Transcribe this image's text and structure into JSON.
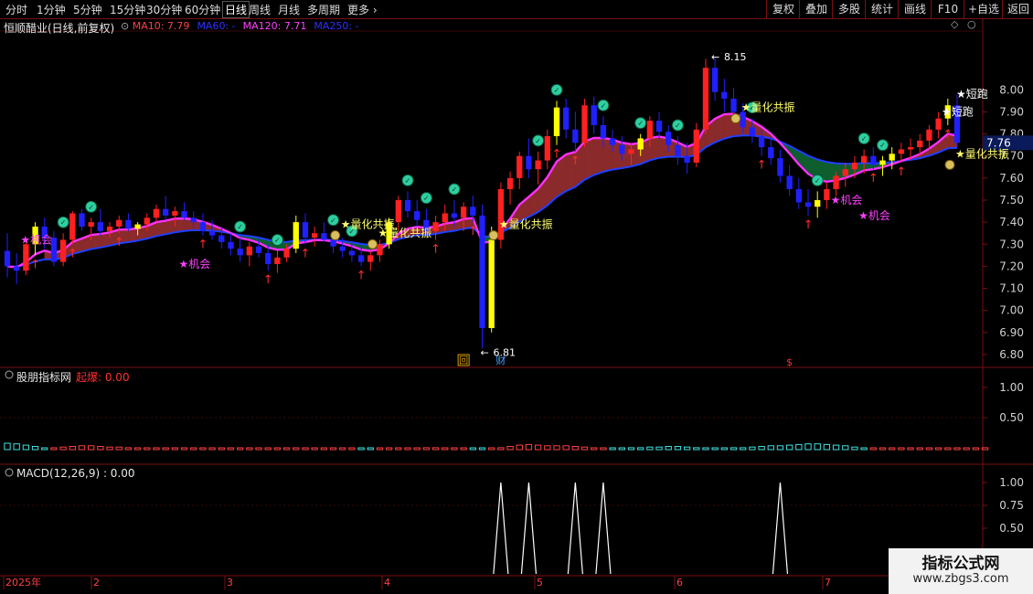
{
  "toolbar": {
    "periods": [
      "分时",
      "1分钟",
      "5分钟",
      "15分钟",
      "30分钟",
      "60分钟",
      "日线",
      "周线",
      "月线",
      "多周期",
      "更多"
    ],
    "active_period": "日线",
    "right_buttons": [
      "复权",
      "叠加",
      "多股",
      "统计",
      "画线",
      "F10",
      "+自选",
      "返回"
    ]
  },
  "main_panel": {
    "title": "恒顺醋业(日线,前复权)",
    "ma_labels": [
      {
        "text": "MA10: 7.79",
        "color": "#ff4040"
      },
      {
        "text": "MA60: -",
        "color": "#3030ff"
      },
      {
        "text": "MA120: 7.71",
        "color": "#ff40ff"
      },
      {
        "text": "MA250: -",
        "color": "#3030ff"
      }
    ],
    "price_ticks": [
      "8.00",
      "7.90",
      "7.80",
      "7.70",
      "7.60",
      "7.50",
      "7.40",
      "7.30",
      "7.20",
      "7.10",
      "7.00",
      "6.90",
      "6.80"
    ],
    "current_price": "7.76",
    "high_label": "8.15",
    "low_label": "6.81",
    "signals": {
      "opportunity": "★机会",
      "resonance": "★量化共振",
      "short_run": "★短跑"
    },
    "markers": {
      "review": "回",
      "finance": "财",
      "dollar": "$"
    }
  },
  "sub_panel_1": {
    "title": "股朋指标网",
    "value_label": "起爆: 0.00",
    "ticks": [
      "1.00",
      "0.50"
    ]
  },
  "sub_panel_2": {
    "title": "MACD(12,26,9) : 0.00",
    "ticks": [
      "1.00",
      "0.75",
      "0.50"
    ]
  },
  "date_axis": {
    "labels": [
      "2025年",
      "2",
      "3",
      "4",
      "5",
      "6",
      "7"
    ]
  },
  "watermark": {
    "line1": "指标公式网",
    "line2": "www.zbgs3.com"
  },
  "colors": {
    "up": "#ff2020",
    "down": "#2020ff",
    "yellow": "#ffff00",
    "grid": "#7a1010",
    "cloud_green": "#0e5e2e",
    "cloud_red": "#8a2a2a",
    "ma_blue": "#2040ff",
    "ma_magenta": "#ff30ff"
  },
  "chart_data": {
    "type": "candlestick",
    "y_range": [
      6.75,
      8.25
    ],
    "candles": [
      [
        7.27,
        7.35,
        7.15,
        7.2
      ],
      [
        7.2,
        7.26,
        7.12,
        7.18
      ],
      [
        7.18,
        7.32,
        7.16,
        7.3
      ],
      [
        7.3,
        7.4,
        7.25,
        7.38
      ],
      [
        7.38,
        7.42,
        7.28,
        7.33
      ],
      [
        7.33,
        7.36,
        7.2,
        7.22
      ],
      [
        7.22,
        7.35,
        7.2,
        7.32
      ],
      [
        7.32,
        7.45,
        7.3,
        7.44
      ],
      [
        7.44,
        7.46,
        7.36,
        7.38
      ],
      [
        7.38,
        7.42,
        7.32,
        7.4
      ],
      [
        7.4,
        7.46,
        7.34,
        7.36
      ],
      [
        7.36,
        7.4,
        7.33,
        7.38
      ],
      [
        7.38,
        7.43,
        7.35,
        7.41
      ],
      [
        7.41,
        7.44,
        7.36,
        7.37
      ],
      [
        7.37,
        7.4,
        7.34,
        7.39
      ],
      [
        7.39,
        7.44,
        7.36,
        7.42
      ],
      [
        7.42,
        7.48,
        7.4,
        7.46
      ],
      [
        7.46,
        7.52,
        7.41,
        7.43
      ],
      [
        7.43,
        7.47,
        7.38,
        7.45
      ],
      [
        7.45,
        7.49,
        7.41,
        7.42
      ],
      [
        7.42,
        7.45,
        7.37,
        7.4
      ],
      [
        7.4,
        7.44,
        7.34,
        7.36
      ],
      [
        7.36,
        7.41,
        7.32,
        7.34
      ],
      [
        7.34,
        7.38,
        7.28,
        7.31
      ],
      [
        7.31,
        7.35,
        7.25,
        7.28
      ],
      [
        7.28,
        7.33,
        7.22,
        7.25
      ],
      [
        7.25,
        7.31,
        7.2,
        7.29
      ],
      [
        7.29,
        7.33,
        7.24,
        7.26
      ],
      [
        7.26,
        7.3,
        7.18,
        7.21
      ],
      [
        7.21,
        7.27,
        7.17,
        7.24
      ],
      [
        7.24,
        7.3,
        7.22,
        7.28
      ],
      [
        7.28,
        7.43,
        7.26,
        7.4
      ],
      [
        7.4,
        7.44,
        7.3,
        7.33
      ],
      [
        7.33,
        7.38,
        7.29,
        7.35
      ],
      [
        7.35,
        7.4,
        7.31,
        7.32
      ],
      [
        7.32,
        7.36,
        7.26,
        7.29
      ],
      [
        7.29,
        7.33,
        7.24,
        7.27
      ],
      [
        7.27,
        7.31,
        7.22,
        7.25
      ],
      [
        7.25,
        7.3,
        7.2,
        7.22
      ],
      [
        7.22,
        7.27,
        7.18,
        7.25
      ],
      [
        7.25,
        7.32,
        7.22,
        7.3
      ],
      [
        7.3,
        7.42,
        7.28,
        7.4
      ],
      [
        7.4,
        7.52,
        7.36,
        7.5
      ],
      [
        7.5,
        7.54,
        7.42,
        7.45
      ],
      [
        7.45,
        7.5,
        7.38,
        7.41
      ],
      [
        7.41,
        7.46,
        7.34,
        7.36
      ],
      [
        7.36,
        7.43,
        7.32,
        7.4
      ],
      [
        7.4,
        7.48,
        7.36,
        7.44
      ],
      [
        7.44,
        7.5,
        7.38,
        7.42
      ],
      [
        7.42,
        7.49,
        7.36,
        7.47
      ],
      [
        7.47,
        7.52,
        7.4,
        7.43
      ],
      [
        7.43,
        7.48,
        6.83,
        6.92
      ],
      [
        6.92,
        7.38,
        6.9,
        7.32
      ],
      [
        7.32,
        7.58,
        7.28,
        7.55
      ],
      [
        7.55,
        7.63,
        7.48,
        7.6
      ],
      [
        7.6,
        7.72,
        7.55,
        7.7
      ],
      [
        7.7,
        7.78,
        7.6,
        7.64
      ],
      [
        7.64,
        7.72,
        7.57,
        7.68
      ],
      [
        7.68,
        7.82,
        7.64,
        7.79
      ],
      [
        7.79,
        7.95,
        7.75,
        7.92
      ],
      [
        7.92,
        7.96,
        7.78,
        7.82
      ],
      [
        7.82,
        7.9,
        7.72,
        7.76
      ],
      [
        7.76,
        7.96,
        7.74,
        7.93
      ],
      [
        7.93,
        7.97,
        7.8,
        7.84
      ],
      [
        7.84,
        7.88,
        7.74,
        7.78
      ],
      [
        7.78,
        7.82,
        7.72,
        7.75
      ],
      [
        7.75,
        7.79,
        7.68,
        7.71
      ],
      [
        7.71,
        7.76,
        7.66,
        7.73
      ],
      [
        7.73,
        7.8,
        7.7,
        7.78
      ],
      [
        7.78,
        7.88,
        7.74,
        7.86
      ],
      [
        7.86,
        7.9,
        7.78,
        7.81
      ],
      [
        7.81,
        7.84,
        7.72,
        7.75
      ],
      [
        7.75,
        7.79,
        7.66,
        7.7
      ],
      [
        7.7,
        7.76,
        7.62,
        7.67
      ],
      [
        7.67,
        7.85,
        7.65,
        7.82
      ],
      [
        7.82,
        8.14,
        7.8,
        8.1
      ],
      [
        8.1,
        8.15,
        7.95,
        7.99
      ],
      [
        7.99,
        8.05,
        7.9,
        7.96
      ],
      [
        7.96,
        8.01,
        7.86,
        7.9
      ],
      [
        7.9,
        7.94,
        7.8,
        7.83
      ],
      [
        7.83,
        7.87,
        7.76,
        7.79
      ],
      [
        7.79,
        7.82,
        7.7,
        7.74
      ],
      [
        7.74,
        7.78,
        7.66,
        7.69
      ],
      [
        7.69,
        7.73,
        7.58,
        7.61
      ],
      [
        7.61,
        7.66,
        7.52,
        7.55
      ],
      [
        7.55,
        7.6,
        7.46,
        7.49
      ],
      [
        7.49,
        7.55,
        7.43,
        7.47
      ],
      [
        7.47,
        7.54,
        7.42,
        7.5
      ],
      [
        7.5,
        7.58,
        7.46,
        7.55
      ],
      [
        7.55,
        7.63,
        7.52,
        7.61
      ],
      [
        7.61,
        7.67,
        7.56,
        7.64
      ],
      [
        7.64,
        7.7,
        7.6,
        7.67
      ],
      [
        7.67,
        7.73,
        7.62,
        7.7
      ],
      [
        7.7,
        7.74,
        7.64,
        7.66
      ],
      [
        7.66,
        7.7,
        7.61,
        7.68
      ],
      [
        7.68,
        7.74,
        7.64,
        7.71
      ],
      [
        7.71,
        7.76,
        7.67,
        7.73
      ],
      [
        7.73,
        7.78,
        7.68,
        7.74
      ],
      [
        7.74,
        7.8,
        7.7,
        7.77
      ],
      [
        7.77,
        7.84,
        7.73,
        7.82
      ],
      [
        7.82,
        7.9,
        7.78,
        7.87
      ],
      [
        7.87,
        7.96,
        7.84,
        7.93
      ],
      [
        7.93,
        7.98,
        7.74,
        7.76
      ]
    ],
    "osc_panel_1": [
      -0.5,
      -0.45,
      -0.35,
      -0.25,
      -0.1,
      0.1,
      0.2,
      0.25,
      0.3,
      0.3,
      0.25,
      0.2,
      0.2,
      0.15,
      0.1,
      0.1,
      0.05,
      0.05,
      0.05,
      0.1,
      0.1,
      0.05,
      0.0,
      0.0,
      0.05,
      0.05,
      0.05,
      0.05,
      0.1,
      0.05,
      0.05,
      0.05,
      0.05,
      0.05,
      0.0,
      0.0,
      0.0,
      0.0,
      -0.05,
      -0.05,
      0.0,
      0.0,
      0.05,
      0.05,
      0.1,
      0.15,
      0.15,
      0.1,
      0.05,
      0.0,
      -0.05,
      -0.05,
      0.05,
      0.15,
      0.25,
      0.35,
      0.4,
      0.35,
      0.3,
      0.3,
      0.3,
      0.25,
      0.2,
      0.1,
      0.05,
      -0.05,
      -0.1,
      -0.15,
      -0.15,
      -0.2,
      -0.2,
      -0.25,
      -0.25,
      -0.2,
      -0.15,
      -0.05,
      -0.05,
      -0.1,
      -0.15,
      -0.15,
      -0.2,
      -0.25,
      -0.3,
      -0.3,
      -0.35,
      -0.4,
      -0.45,
      -0.45,
      -0.4,
      -0.35,
      -0.3,
      -0.2,
      -0.1,
      0.0,
      0.05,
      0.1,
      0.1,
      0.1,
      0.1,
      0.1,
      0.1,
      0.1,
      0.1,
      0.1,
      0.1,
      0.15
    ],
    "spikes_panel_2": [
      {
        "index": 53,
        "value": 1.0
      },
      {
        "index": 56,
        "value": 1.0
      },
      {
        "index": 61,
        "value": 1.0
      },
      {
        "index": 64,
        "value": 1.0
      },
      {
        "index": 83,
        "value": 1.0
      }
    ]
  }
}
